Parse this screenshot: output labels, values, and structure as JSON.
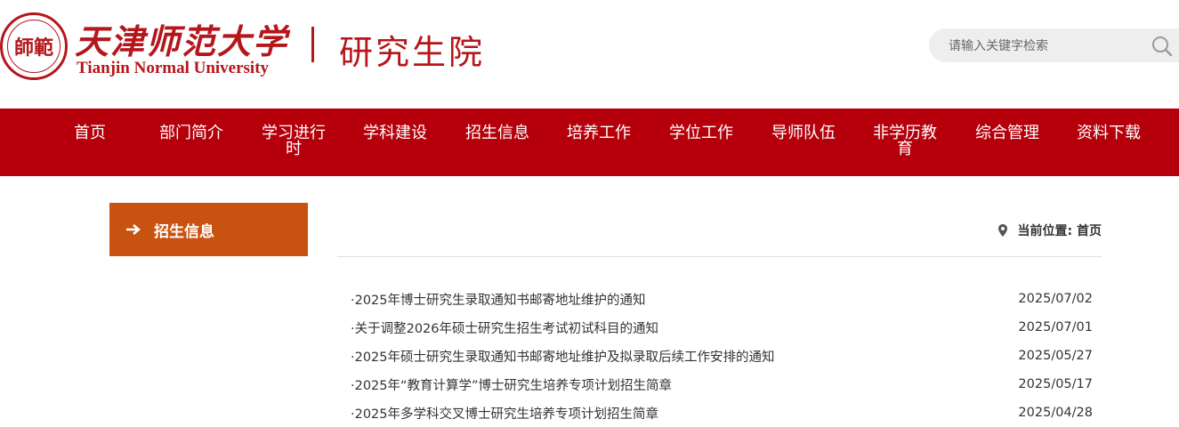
{
  "header": {
    "seal_text": "師範",
    "university_cn": "天津师范大学",
    "university_en": "Tianjin Normal University",
    "department": "研究生院",
    "search_placeholder": "请输入关键字检索"
  },
  "colors": {
    "brand_red": "#b5000b",
    "sidebar_orange": "#c8520f"
  },
  "nav": {
    "items": [
      {
        "label": "首页"
      },
      {
        "label": "部门简介"
      },
      {
        "label": "学习进行时"
      },
      {
        "label": "学科建设"
      },
      {
        "label": "招生信息"
      },
      {
        "label": "培养工作"
      },
      {
        "label": "学位工作"
      },
      {
        "label": "导师队伍"
      },
      {
        "label": "非学历教育"
      },
      {
        "label": "综合管理"
      },
      {
        "label": "资料下载"
      }
    ]
  },
  "sidebar": {
    "title": "招生信息",
    "icon": "arrow-right-icon"
  },
  "location": {
    "icon": "map-pin-icon",
    "label": "当前位置: 首页"
  },
  "news": [
    {
      "title": "·2025年博士研究生录取通知书邮寄地址维护的通知",
      "date": "2025/07/02"
    },
    {
      "title": "·关于调整2026年硕士研究生招生考试初试科目的通知",
      "date": "2025/07/01"
    },
    {
      "title": "·2025年硕士研究生录取通知书邮寄地址维护及拟录取后续工作安排的通知",
      "date": "2025/05/27"
    },
    {
      "title": "·2025年“教育计算学”博士研究生培养专项计划招生简章",
      "date": "2025/05/17"
    },
    {
      "title": "·2025年多学科交叉博士研究生培养专项计划招生简章",
      "date": "2025/04/28"
    }
  ]
}
